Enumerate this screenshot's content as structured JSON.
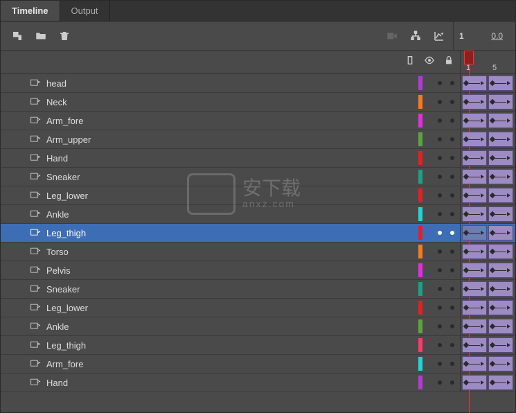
{
  "tabs": [
    {
      "label": "Timeline",
      "active": true
    },
    {
      "label": "Output",
      "active": false
    }
  ],
  "frame_header": {
    "frame": "1",
    "time": "0.0"
  },
  "ruler": {
    "marks": [
      "1",
      "5"
    ]
  },
  "column_icons": [
    "type-icon",
    "eye-icon",
    "lock-icon"
  ],
  "layers": [
    {
      "name": "head",
      "color": "#b43ad6",
      "selected": false
    },
    {
      "name": "Neck",
      "color": "#f77b1c",
      "selected": false
    },
    {
      "name": "Arm_fore",
      "color": "#e82be0",
      "selected": false
    },
    {
      "name": "Arm_upper",
      "color": "#5aa63a",
      "selected": false
    },
    {
      "name": "Hand",
      "color": "#e62020",
      "selected": false
    },
    {
      "name": "Sneaker",
      "color": "#1aa186",
      "selected": false
    },
    {
      "name": "Leg_lower",
      "color": "#e62020",
      "selected": false
    },
    {
      "name": "Ankle",
      "color": "#1fd6d6",
      "selected": false
    },
    {
      "name": "Leg_thigh",
      "color": "#e62020",
      "selected": true
    },
    {
      "name": "Torso",
      "color": "#f77b1c",
      "selected": false
    },
    {
      "name": "Pelvis",
      "color": "#e82be0",
      "selected": false
    },
    {
      "name": "Sneaker",
      "color": "#1aa186",
      "selected": false
    },
    {
      "name": "Leg_lower",
      "color": "#e62020",
      "selected": false
    },
    {
      "name": "Ankle",
      "color": "#5aa63a",
      "selected": false
    },
    {
      "name": "Leg_thigh",
      "color": "#ff3a6a",
      "selected": false
    },
    {
      "name": "Arm_fore",
      "color": "#1fd6d6",
      "selected": false
    },
    {
      "name": "Hand",
      "color": "#b43ad6",
      "selected": false
    }
  ],
  "watermark": {
    "main": "安下载",
    "sub": "anxz.com"
  }
}
